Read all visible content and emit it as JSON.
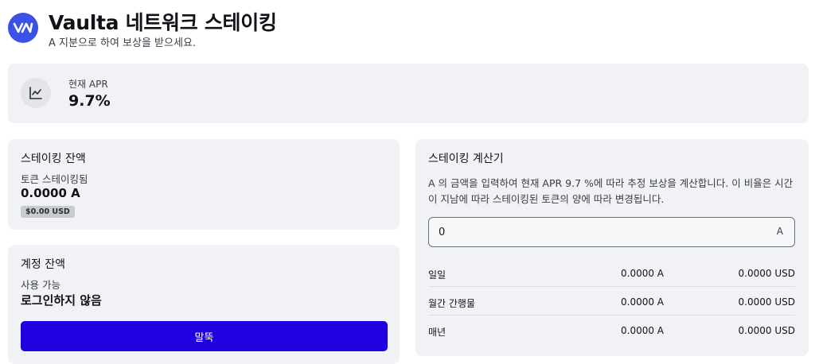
{
  "header": {
    "title": "Vaulta 네트워크 스테이킹",
    "subtitle": "A 지분으로 하여 보상을 받으세요."
  },
  "apr": {
    "label": "현재 APR",
    "value": "9.7%"
  },
  "staking_balance": {
    "title": "스테이킹 잔액",
    "label": "토큰 스테이킹됨",
    "value": "0.0000 A",
    "usd_badge": "$0.00 USD"
  },
  "account_balance": {
    "title": "계정 잔액",
    "label": "사용 가능",
    "value": "로그인하지 않음",
    "button_label": "말뚝"
  },
  "calculator": {
    "title": "스테이킹 계산기",
    "description": "A 의 금액을 입력하여 현재 APR 9.7 %에 따라 추정 보상을 계산합니다. 이 비율은 시간이 지남에 따라 스테이킹된 토큰의 양에 따라 변경됩니다.",
    "input_value": "0",
    "input_unit": "A",
    "rows": [
      {
        "period": "일일",
        "token": "0.0000 A",
        "usd": "0.0000 USD"
      },
      {
        "period": "월간 간행물",
        "token": "0.0000 A",
        "usd": "0.0000 USD"
      },
      {
        "period": "매년",
        "token": "0.0000 A",
        "usd": "0.0000 USD"
      }
    ]
  },
  "colors": {
    "accent": "#1f00de",
    "logo": "#3b52e6",
    "card_bg": "#f1f2f6"
  },
  "icons": {
    "logo": "vaulta-logo-icon",
    "apr": "line-chart-icon"
  }
}
